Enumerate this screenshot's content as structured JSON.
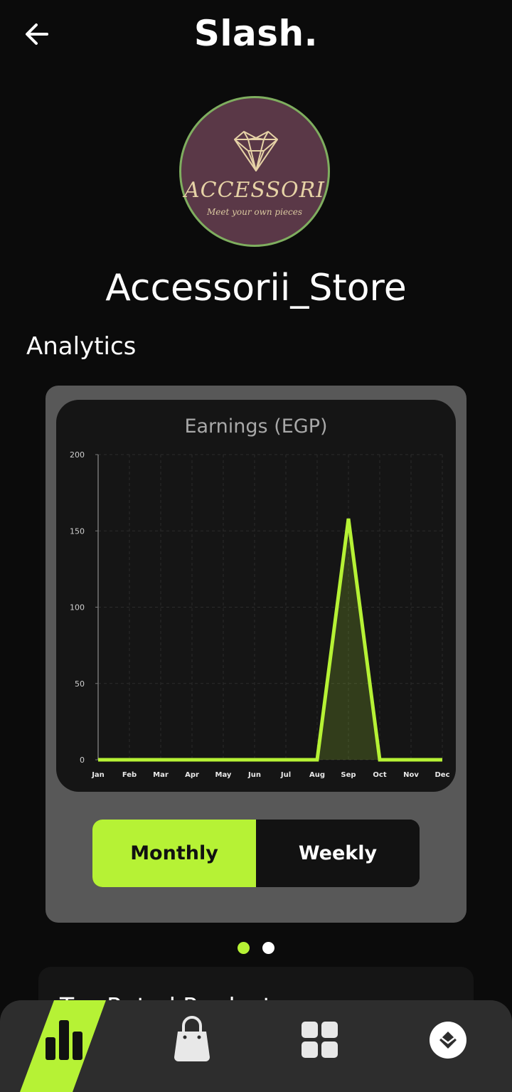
{
  "header": {
    "title": "Slash.",
    "back_icon": "arrow-left-icon"
  },
  "store": {
    "logo_text": "ACCESSORI",
    "logo_tagline": "Meet your own pieces",
    "name": "Accessorii_Store"
  },
  "analytics": {
    "section_title": "Analytics",
    "toggle": {
      "monthly_label": "Monthly",
      "weekly_label": "Weekly",
      "selected": "Monthly"
    },
    "pager": {
      "count": 2,
      "active_index": 0
    }
  },
  "next_section": {
    "title": "Top Rated Products"
  },
  "colors": {
    "accent": "#b6f235",
    "background": "#0b0b0b",
    "card": "#585858",
    "chart_bg": "#151515",
    "nav_bg": "#2d2d2d"
  },
  "bottom_nav": [
    {
      "name": "analytics-tab",
      "icon": "bar-chart-icon",
      "active": true
    },
    {
      "name": "products-tab",
      "icon": "shopping-bag-icon",
      "active": false
    },
    {
      "name": "categories-tab",
      "icon": "grid-icon",
      "active": false
    },
    {
      "name": "profile-tab",
      "icon": "diamond-badge-icon",
      "active": false
    }
  ],
  "chart_data": {
    "type": "area",
    "title": "Earnings (EGP)",
    "categories": [
      "Jan",
      "Feb",
      "Mar",
      "Apr",
      "May",
      "Jun",
      "Jul",
      "Aug",
      "Sep",
      "Oct",
      "Nov",
      "Dec"
    ],
    "series": [
      {
        "values": [
          0,
          0,
          0,
          0,
          0,
          0,
          0,
          0,
          158,
          0,
          0,
          0
        ]
      }
    ],
    "ylim": [
      0,
      200
    ],
    "yticks": [
      0,
      50,
      100,
      150,
      200
    ],
    "grid": true
  }
}
